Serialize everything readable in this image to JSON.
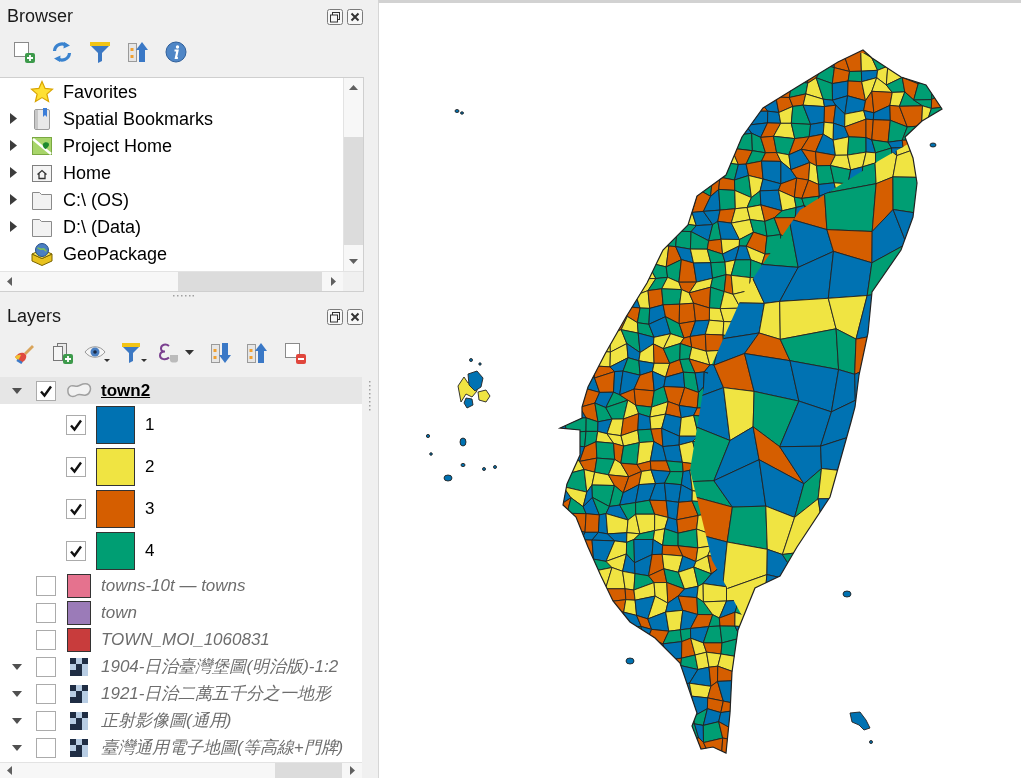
{
  "browser_panel": {
    "title": "Browser",
    "items": [
      {
        "label": "Favorites",
        "kind": "favorites"
      },
      {
        "label": "Spatial Bookmarks",
        "kind": "bookmarks",
        "expanded": false
      },
      {
        "label": "Project Home",
        "kind": "project_home",
        "expanded": false
      },
      {
        "label": "Home",
        "kind": "home",
        "expanded": false
      },
      {
        "label": "C:\\ (OS)",
        "kind": "drive",
        "expanded": false
      },
      {
        "label": "D:\\ (Data)",
        "kind": "drive",
        "expanded": false
      },
      {
        "label": "GeoPackage",
        "kind": "geopackage"
      }
    ]
  },
  "layers_panel": {
    "title": "Layers",
    "layers": [
      {
        "name": "town2",
        "kind": "polygon",
        "checked": true,
        "selected": true,
        "expanded": true,
        "children": [
          {
            "label": "1",
            "checked": true,
            "color": "#0072b2"
          },
          {
            "label": "2",
            "checked": true,
            "color": "#f0e442"
          },
          {
            "label": "3",
            "checked": true,
            "color": "#d55e00"
          },
          {
            "label": "4",
            "checked": true,
            "color": "#009e73"
          }
        ]
      },
      {
        "name": "towns-10t — towns",
        "kind": "fill",
        "checked": false,
        "selected": false,
        "color": "#e5728e"
      },
      {
        "name": "town",
        "kind": "fill",
        "checked": false,
        "selected": false,
        "color": "#9b7bb8"
      },
      {
        "name": "TOWN_MOI_1060831",
        "kind": "fill",
        "checked": false,
        "selected": false,
        "color": "#c83c3c"
      },
      {
        "name": "1904-日治臺灣堡圖(明治版)-1:2",
        "kind": "raster",
        "checked": false,
        "selected": false,
        "expanded": true
      },
      {
        "name": "1921-日治二萬五千分之一地形",
        "kind": "raster",
        "checked": false,
        "selected": false,
        "expanded": true
      },
      {
        "name": "正射影像圖(通用)",
        "kind": "raster",
        "checked": false,
        "selected": false,
        "expanded": true
      },
      {
        "name": "臺灣通用電子地圖(等高線+門牌)",
        "kind": "raster",
        "checked": false,
        "selected": false,
        "expanded": true
      }
    ]
  }
}
